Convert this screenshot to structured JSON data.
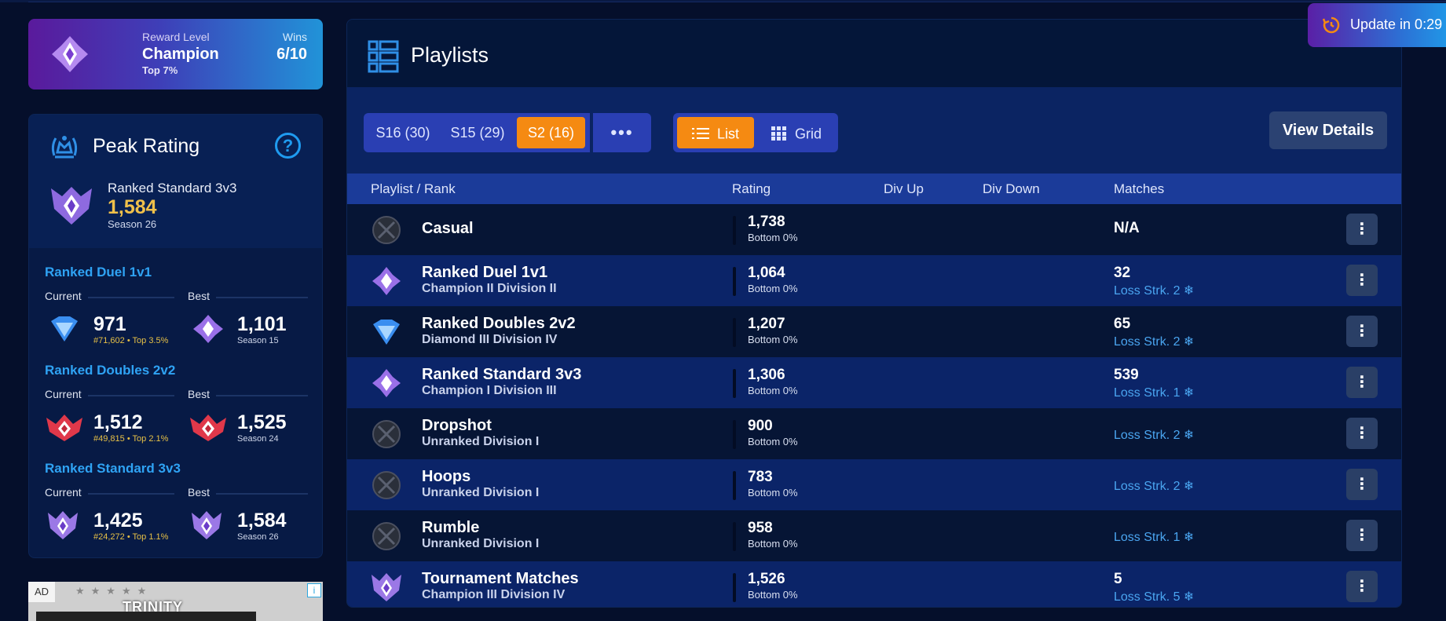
{
  "reward": {
    "level_label": "Reward Level",
    "level_value": "Champion",
    "level_sub": "Top 7%",
    "wins_label": "Wins",
    "wins_value": "6/10"
  },
  "peak": {
    "title": "Peak Rating",
    "help": "?",
    "playlist": "Ranked Standard 3v3",
    "rating": "1,584",
    "season": "Season 26"
  },
  "modes": [
    {
      "name": "Ranked Duel 1v1",
      "current_label": "Current",
      "best_label": "Best",
      "current_value": "971",
      "current_sub": "#71,602 • Top 3.5%",
      "best_value": "1,101",
      "best_sub": "Season 15",
      "current_icon": "diamond-rank-icon",
      "best_icon": "champion-rank-icon"
    },
    {
      "name": "Ranked Doubles 2v2",
      "current_label": "Current",
      "best_label": "Best",
      "current_value": "1,512",
      "current_sub": "#49,815 • Top 2.1%",
      "best_value": "1,525",
      "best_sub": "Season 24",
      "current_icon": "grand-champion-rank-icon",
      "best_icon": "grand-champion-rank-icon"
    },
    {
      "name": "Ranked Standard 3v3",
      "current_label": "Current",
      "best_label": "Best",
      "current_value": "1,425",
      "current_sub": "#24,272 • Top 1.1%",
      "best_value": "1,584",
      "best_sub": "Season 26",
      "current_icon": "champion-iii-rank-icon",
      "best_icon": "champion-iii-rank-icon"
    }
  ],
  "ad": {
    "tag": "AD",
    "info": "i",
    "text": "TRINITY"
  },
  "update": {
    "text": "Update in 0:29",
    "icon": "refresh-timer-icon"
  },
  "playlists": {
    "title": "Playlists",
    "seasons": [
      "S16 (30)",
      "S15 (29)",
      "S2 (16)"
    ],
    "active_season": "S2 (16)",
    "more": "•••",
    "view_list": "List",
    "view_grid": "Grid",
    "view_details": "View Details",
    "columns": [
      "Playlist / Rank",
      "Rating",
      "Div Up",
      "Div Down",
      "Matches"
    ],
    "rows": [
      {
        "name": "Casual",
        "rank": "",
        "rating": "1,738",
        "pct": "Bottom 0%",
        "matches": "N/A",
        "streak": "",
        "icon": "unranked-icon"
      },
      {
        "name": "Ranked Duel 1v1",
        "rank": "Champion II Division II",
        "rating": "1,064",
        "pct": "Bottom 0%",
        "matches": "32",
        "streak": "Loss Strk. 2 ❄",
        "icon": "champion-rank-icon"
      },
      {
        "name": "Ranked Doubles 2v2",
        "rank": "Diamond III Division IV",
        "rating": "1,207",
        "pct": "Bottom 0%",
        "matches": "65",
        "streak": "Loss Strk. 2 ❄",
        "icon": "diamond-rank-icon"
      },
      {
        "name": "Ranked Standard 3v3",
        "rank": "Champion I Division III",
        "rating": "1,306",
        "pct": "Bottom 0%",
        "matches": "539",
        "streak": "Loss Strk. 1 ❄",
        "icon": "champion-rank-icon"
      },
      {
        "name": "Dropshot",
        "rank": "Unranked Division I",
        "rating": "900",
        "pct": "Bottom 0%",
        "matches": "",
        "streak": "Loss Strk. 2 ❄",
        "icon": "unranked-icon"
      },
      {
        "name": "Hoops",
        "rank": "Unranked Division I",
        "rating": "783",
        "pct": "Bottom 0%",
        "matches": "",
        "streak": "Loss Strk. 2 ❄",
        "icon": "unranked-icon"
      },
      {
        "name": "Rumble",
        "rank": "Unranked Division I",
        "rating": "958",
        "pct": "Bottom 0%",
        "matches": "",
        "streak": "Loss Strk. 1 ❄",
        "icon": "unranked-icon"
      },
      {
        "name": "Tournament Matches",
        "rank": "Champion III Division IV",
        "rating": "1,526",
        "pct": "Bottom 0%",
        "matches": "5",
        "streak": "Loss Strk. 5 ❄",
        "icon": "champion-iii-rank-icon"
      }
    ],
    "row_menu": "⋮"
  },
  "colors": {
    "background": "#050f2b",
    "accent_orange": "#f58a12",
    "accent_blue": "#2fa3f4",
    "gold": "#f0c04a"
  }
}
